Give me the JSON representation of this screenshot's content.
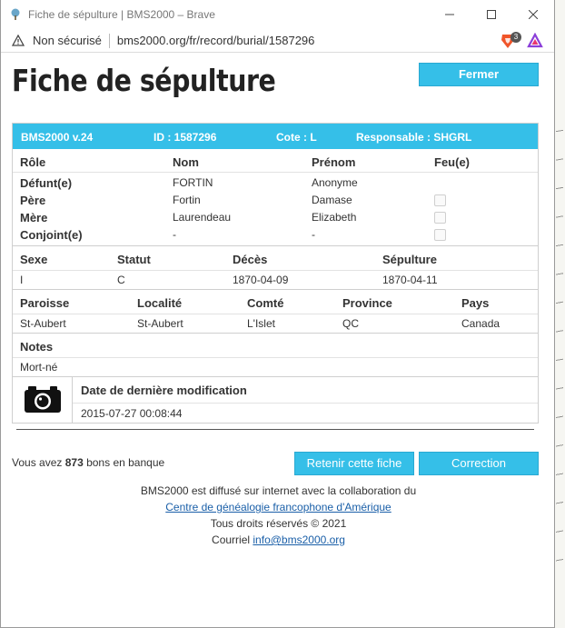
{
  "window": {
    "title": "Fiche de sépulture | BMS2000 – Brave",
    "not_secure": "Non sécurisé",
    "url": "bms2000.org/fr/record/burial/1587296",
    "shield_badge": "3"
  },
  "page": {
    "title": "Fiche de sépulture",
    "close_button": "Fermer"
  },
  "record": {
    "version": "BMS2000 v.24",
    "id": "ID : 1587296",
    "cote": "Cote : L",
    "responsable": "Responsable : SHGRL",
    "people_headers": {
      "role": "Rôle",
      "nom": "Nom",
      "prenom": "Prénom",
      "feu": "Feu(e)"
    },
    "people": [
      {
        "role": "Défunt(e)",
        "nom": "FORTIN",
        "prenom": "Anonyme",
        "checkbox": false
      },
      {
        "role": "Père",
        "nom": "Fortin",
        "prenom": "Damase",
        "checkbox": true
      },
      {
        "role": "Mère",
        "nom": "Laurendeau",
        "prenom": "Elizabeth",
        "checkbox": true
      },
      {
        "role": "Conjoint(e)",
        "nom": "-",
        "prenom": "-",
        "checkbox": true
      }
    ],
    "info_headers": {
      "sexe": "Sexe",
      "statut": "Statut",
      "deces": "Décès",
      "sepulture": "Sépulture"
    },
    "info": {
      "sexe": "I",
      "statut": "C",
      "deces": "1870-04-09",
      "sepulture": "1870-04-11"
    },
    "place_headers": {
      "paroisse": "Paroisse",
      "localite": "Localité",
      "comte": "Comté",
      "province": "Province",
      "pays": "Pays"
    },
    "place": {
      "paroisse": "St-Aubert",
      "localite": "St-Aubert",
      "comte": "L'Islet",
      "province": "QC",
      "pays": "Canada"
    },
    "notes_header": "Notes",
    "notes": "Mort-né",
    "modif_label": "Date de dernière modification",
    "modif_value": "2015-07-27 00:08:44"
  },
  "bank": {
    "prefix": "Vous avez ",
    "count": "873",
    "suffix": " bons en banque"
  },
  "buttons": {
    "retenir": "Retenir cette fiche",
    "correction": "Correction"
  },
  "footer": {
    "line1": "BMS2000 est diffusé sur internet avec la collaboration du",
    "link": "Centre de généalogie francophone d'Amérique",
    "copyright": "Tous droits réservés © 2021",
    "courriel_label": "Courriel ",
    "email": "info@bms2000.org"
  },
  "colors": {
    "accent": "#35bfe8",
    "link": "#1a5fa8"
  }
}
